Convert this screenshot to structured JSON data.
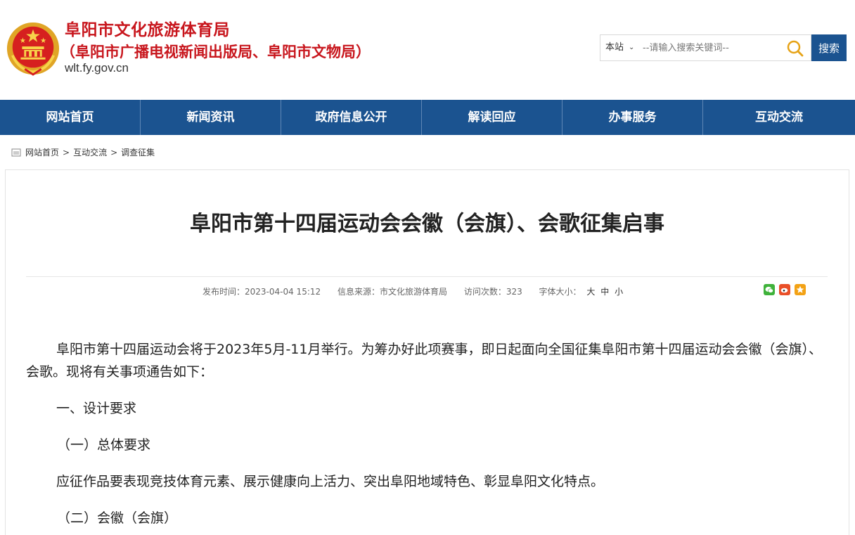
{
  "header": {
    "title": "阜阳市文化旅游体育局",
    "subtitle": "（阜阳市广播电视新闻出版局、阜阳市文物局）",
    "domain": "wlt.fy.gov.cn",
    "emblem_icon": "national-emblem-icon"
  },
  "search": {
    "scope": "本站",
    "placeholder": "--请输入搜索关键词--",
    "button_label": "搜索"
  },
  "nav": {
    "items": [
      "网站首页",
      "新闻资讯",
      "政府信息公开",
      "解读回应",
      "办事服务",
      "互动交流"
    ]
  },
  "breadcrumb": {
    "items": [
      "网站首页",
      "互动交流",
      "调查征集"
    ],
    "separator": ">"
  },
  "article": {
    "title": "阜阳市第十四届运动会会徽（会旗）、会歌征集启事",
    "meta": {
      "published": "发布时间：2023-04-04 15:12",
      "source": "信息来源：市文化旅游体育局",
      "visits": "访问次数：323",
      "font_size_label": "字体大小：",
      "font_large": "大",
      "font_medium": "中",
      "font_small": "小"
    },
    "share_icons": [
      "wechat-icon",
      "weibo-icon",
      "qzone-icon"
    ],
    "paragraphs": [
      "阜阳市第十四届运动会将于2023年5月-11月举行。为筹办好此项赛事，即日起面向全国征集阜阳市第十四届运动会会徽（会旗）、会歌。现将有关事项通告如下：",
      "一、设计要求",
      "（一）总体要求",
      "应征作品要表现竞技体育元素、展示健康向上活力、突出阜阳地域特色、彰显阜阳文化特点。",
      "（二）会徽（会旗）"
    ]
  },
  "colors": {
    "brand_red": "#c8161d",
    "nav_blue": "#1b5390"
  }
}
